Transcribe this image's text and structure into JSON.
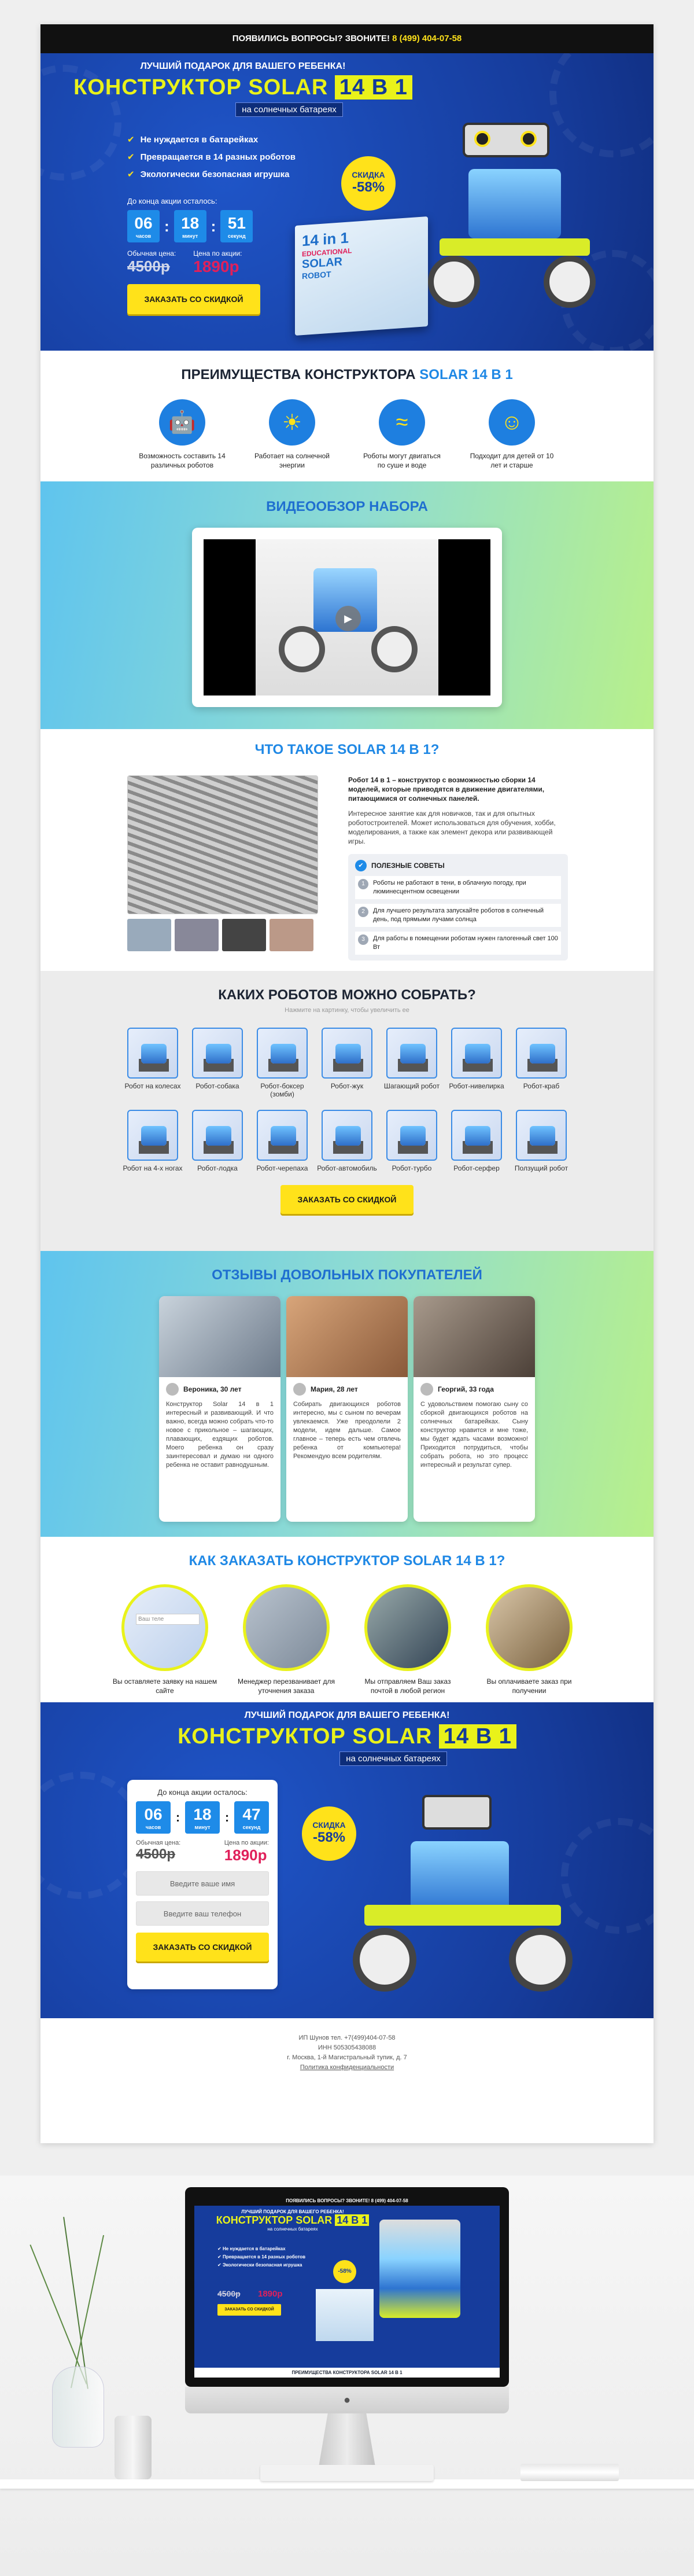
{
  "topbar": {
    "text": "ПОЯВИЛИСЬ ВОПРОСЫ? ЗВОНИТЕ!",
    "phone": "8 (499) 404-07-58"
  },
  "hero": {
    "pretitle": "ЛУЧШИЙ ПОДАРОК ДЛЯ ВАШЕГО РЕБЕНКА!",
    "title": "КОНСТРУКТОР SOLAR",
    "title_hl": "14 В 1",
    "subtitle": "на солнечных батареях",
    "features": [
      "Не нуждается в батарейках",
      "Превращается в 14 разных роботов",
      "Экологически безопасная игрушка"
    ],
    "countdown_label": "До конца акции осталось:",
    "timer": {
      "h": "06",
      "m": "18",
      "s": "51"
    },
    "timer_units": {
      "h": "часов",
      "m": "минут",
      "s": "секунд"
    },
    "old_label": "Обычная цена:",
    "old_price": "4500р",
    "new_label": "Цена по акции:",
    "new_price": "1890р",
    "cta": "ЗАКАЗАТЬ СО СКИДКОЙ",
    "badge_top": "СКИДКА",
    "badge_val": "-58%"
  },
  "box": {
    "line1": "14 in 1",
    "line2": "EDUCATIONAL",
    "line3": "SOLAR",
    "line4": "ROBOT"
  },
  "advantages": {
    "title": "ПРЕИМУЩЕСТВА КОНСТРУКТОРА",
    "title_hl": "SOLAR 14 В 1",
    "items": [
      "Возможность составить 14 различных роботов",
      "Работает на солнечной энергии",
      "Роботы могут двигаться по суше и воде",
      "Подходит для детей от 10 лет и старше"
    ]
  },
  "video": {
    "title": "ВИДЕООБЗОР НАБОРА"
  },
  "about": {
    "title": "ЧТО ТАКОЕ SOLAR",
    "title_hl": "14 В 1?",
    "lead": "Робот 14 в 1 – конструктор с возможностью сборки 14 моделей, которые приводятся в движение двигателями, питающимися от солнечных панелей.",
    "body": "Интересное занятие как для новичков, так и для опытных роботостроителей. Может использоваться для обучения, хобби, моделирования, а также как элемент декора или развивающей игры.",
    "tips_title": "ПОЛЕЗНЫЕ СОВЕТЫ",
    "tips": [
      "Роботы не работают в тени, в облачную погоду, при люминесцентном освещении",
      "Для лучшего результата запускайте роботов в солнечный день, под прямыми лучами солнца",
      "Для работы в помещении роботам нужен галогенный свет 100 Вт"
    ]
  },
  "robots": {
    "title": "КАКИХ РОБОТОВ МОЖНО СОБРАТЬ?",
    "hint": "Нажмите на картинку, чтобы увеличить ее",
    "row1": [
      "Робот на колесах",
      "Робот-собака",
      "Робот-боксер (зомби)",
      "Робот-жук",
      "Шагающий робот",
      "Робот-нивелирка",
      "Робот-краб"
    ],
    "row2": [
      "Робот на 4-х ногах",
      "Робот-лодка",
      "Робот-черепаха",
      "Робот-автомобиль",
      "Робот-турбо",
      "Робот-серфер",
      "Ползущий робот"
    ],
    "cta": "ЗАКАЗАТЬ СО СКИДКОЙ"
  },
  "reviews": {
    "title": "ОТЗЫВЫ ДОВОЛЬНЫХ ПОКУПАТЕЛЕЙ",
    "items": [
      {
        "name": "Вероника, 30 лет",
        "text": "Конструктор Solar 14 в 1 интересный и развивающий. И что важно, всегда можно собрать что-то новое с прикольное – шагающих, плавающих, ездящих роботов. Моего ребенка он сразу заинтересовал и думаю ни одного ребенка не оставит равнодушным."
      },
      {
        "name": "Мария, 28 лет",
        "text": "Собирать двигающихся роботов интересно, мы с сыном по вечерам увлекаемся. Уже преодолели 2 модели, идем дальше. Самое главное – теперь есть чем отвлечь ребенка от компьютера! Рекомендую всем родителям."
      },
      {
        "name": "Георгий, 33 года",
        "text": "С удовольствием помогаю сыну со сборкой двигающихся роботов на солнечных батарейках. Сыну конструктор нравится и мне тоже, мы будет ждать часами возможно! Приходится потрудиться, чтобы собрать робота, но это процесс интересный и результат супер."
      }
    ]
  },
  "order": {
    "title": "КАК ЗАКАЗАТЬ КОНСТРУКТОР",
    "title_hl": "SOLAR 14 В 1?",
    "steps": [
      "Вы оставляете заявку на нашем сайте",
      "Менеджер перезванивает для уточнения заказа",
      "Мы отправляем Ваш заказ почтой в любой регион",
      "Вы оплачиваете заказ при получении"
    ],
    "form_hint": "Ваш теле"
  },
  "final": {
    "pretitle": "ЛУЧШИЙ ПОДАРОК ДЛЯ ВАШЕГО РЕБЕНКА!",
    "title": "КОНСТРУКТОР SOLAR",
    "title_hl": "14 В 1",
    "subtitle": "на солнечных батареях",
    "countdown_label": "До конца акции осталось:",
    "timer": {
      "h": "06",
      "m": "18",
      "s": "47"
    },
    "timer_units": {
      "h": "часов",
      "m": "минут",
      "s": "секунд"
    },
    "old_label": "Обычная цена:",
    "old_price": "4500р",
    "new_label": "Цена по акции:",
    "new_price": "1890р",
    "name_placeholder": "Введите ваше имя",
    "phone_placeholder": "Введите ваш телефон",
    "cta": "ЗАКАЗАТЬ СО СКИДКОЙ",
    "badge_top": "СКИДКА",
    "badge_val": "-58%"
  },
  "footer": {
    "l1": "ИП Шунов тел. +7(499)404-07-58",
    "l2": "ИНН 505305438088",
    "l3": "г. Москва, 1-й Магистральный тупик, д. 7",
    "l4": "Политика конфиденциальности"
  },
  "mockup": {
    "top": "ПОЯВИЛИСЬ ВОПРОСЫ? ЗВОНИТЕ! 8 (499) 404-07-58",
    "pre": "ЛУЧШИЙ ПОДАРОК ДЛЯ ВАШЕГО РЕБЕНКА!",
    "title": "КОНСТРУКТОР SOLAR",
    "hl": "14 В 1",
    "sub": "на солнечных батареях",
    "f1": "Не нуждается в батарейках",
    "f2": "Превращается в 14 разных роботов",
    "f3": "Экологически безопасная игрушка",
    "old": "4500р",
    "new": "1890р",
    "badge": "-58%",
    "cta": "ЗАКАЗАТЬ СО СКИДКОЙ",
    "bottom": "ПРЕИМУЩЕСТВА КОНСТРУКТОРА SOLAR 14 В 1"
  },
  "colors": {
    "accent": "#1e8be8",
    "yellow": "#e9f21a",
    "button": "#ffe21a",
    "navy": "#163c9c",
    "price_red": "#e0205b"
  }
}
